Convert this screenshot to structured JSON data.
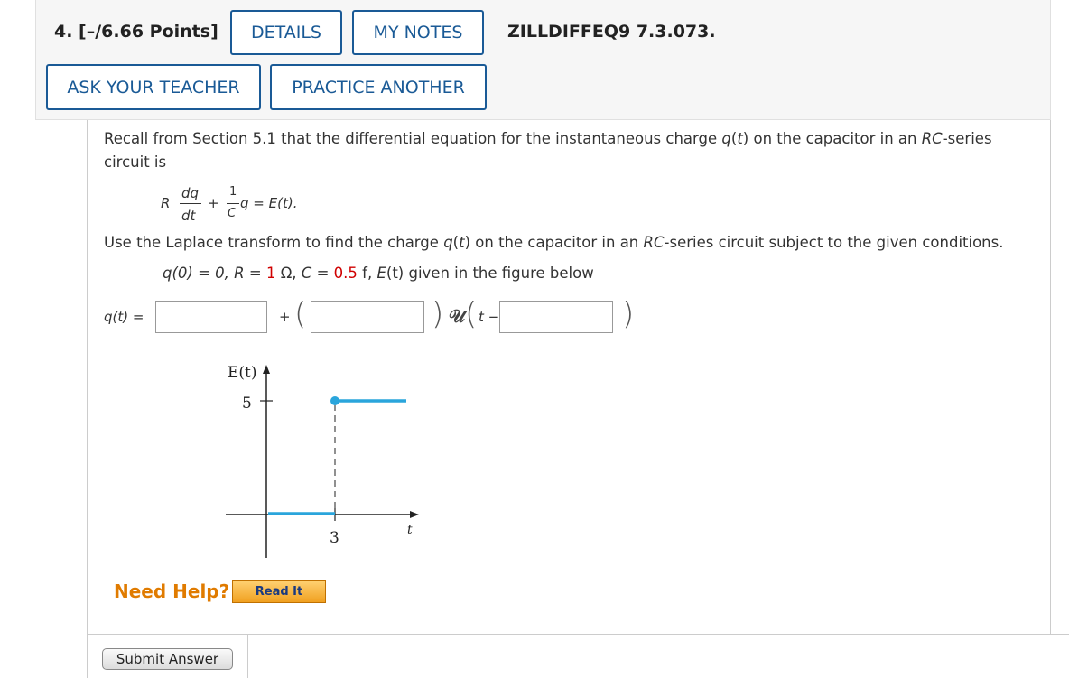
{
  "question": {
    "number_points": "4. [–/6.66 Points]",
    "details_label": "DETAILS",
    "notes_label": "MY NOTES",
    "problem_id": "ZILLDIFFEQ9 7.3.073.",
    "ask_teacher_label": "ASK YOUR TEACHER",
    "practice_label": "PRACTICE ANOTHER"
  },
  "body": {
    "line1_a": "Recall from Section 5.1 that the differential equation for the instantaneous charge ",
    "line1_q": "q",
    "line1_b": "(",
    "line1_t": "t",
    "line1_c": ") on the capacitor in an ",
    "line1_rc": "RC",
    "line1_d": "-series",
    "line2": "circuit is",
    "eq_R": "R",
    "eq_dq": "dq",
    "eq_dt": "dt",
    "eq_plus": "+",
    "eq_one": "1",
    "eq_C": "C",
    "eq_rest": "q = E(t).",
    "line3_a": "Use the Laplace transform to find the charge ",
    "line3_q": "q",
    "line3_b": "(",
    "line3_t": "t",
    "line3_c": ") on the capacitor in an ",
    "line3_rc": "RC",
    "line3_d": "-series circuit subject to the given conditions.",
    "cond_a": "q(0) = 0, ",
    "cond_R": "R",
    "cond_eq1": " = ",
    "cond_Rval": "1",
    "cond_ohm": " Ω, ",
    "cond_C": "C",
    "cond_eq2": " = ",
    "cond_Cval": "0.5",
    "cond_f": " f, ",
    "cond_E": "E",
    "cond_rest": "(t) given in the figure below"
  },
  "answer": {
    "label": "q(t) =",
    "plus": "+",
    "lparen": "(",
    "rparen": ")",
    "unit_step": "𝒰",
    "lparen2": "(",
    "t_minus": "t −",
    "rparen2": ")",
    "input1_value": "",
    "input2_value": "",
    "input3_value": ""
  },
  "graph": {
    "ylabel": "E(t)",
    "ytick": "5",
    "xtick": "3",
    "xlabel": "t",
    "line_color": "#2aa5dc"
  },
  "help": {
    "need_help": "Need Help?",
    "read_it": "Read It",
    "submit": "Submit Answer"
  }
}
